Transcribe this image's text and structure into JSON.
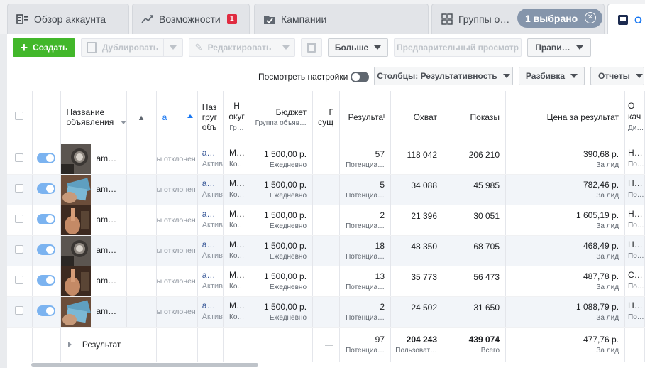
{
  "tabs": [
    {
      "label": "Обзор аккаунта",
      "icon": "account-overview-icon"
    },
    {
      "label": "Возможности",
      "icon": "trend-icon",
      "badge": "1"
    },
    {
      "label": "Кампании",
      "icon": "campaign-folder-icon"
    },
    {
      "label": "Группы о…",
      "icon": "ad-sets-grid-icon"
    },
    {
      "label": "О",
      "icon": "ads-icon"
    }
  ],
  "selection": {
    "label": "1 выбрано"
  },
  "toolbar": {
    "create": "Создать",
    "duplicate": "Дублировать",
    "edit": "Редактировать",
    "more": "Больше",
    "preview": "Предварительный просмотр",
    "rules": "Прави…"
  },
  "view_bar": {
    "view_settings": "Посмотреть настройки",
    "columns": "Столбцы: Результативность",
    "breakdown": "Разбивка",
    "reports": "Отчеты"
  },
  "columns": {
    "name": [
      "Название",
      "объявления"
    ],
    "delivery": "а",
    "adset_name": [
      "Наз",
      "груг",
      "объ"
    ],
    "audience": [
      "Н",
      "окуг",
      "Гр…"
    ],
    "budget": "Бюджет",
    "budget_sub": "Группа объяв…",
    "existing": [
      "Г",
      "сущ"
    ],
    "results": "Результаᴵ",
    "reach": "Охват",
    "impressions": "Показы",
    "cpr": "Цена за результат",
    "quality": [
      "О",
      "кач",
      "Ди…"
    ]
  },
  "rows": [
    {
      "name": "am…",
      "delivery": "ы отклонен",
      "adset": [
        "а…",
        "Актив"
      ],
      "aud": [
        "М…",
        "Ко…"
      ],
      "budget": "1 500,00 р.",
      "period": "Ежедневно",
      "results": "57",
      "res_sub": "Потенциа…",
      "reach": "118 042",
      "impressions": "206 210",
      "cpr": "390,68 р.",
      "cpr_sub": "За лид",
      "q": [
        "Н…",
        "По…"
      ],
      "thumb": "watch"
    },
    {
      "name": "am…",
      "delivery": "ы отклонен",
      "adset": [
        "а…",
        "Актив"
      ],
      "aud": [
        "М…",
        "Ко…"
      ],
      "budget": "1 500,00 р.",
      "period": "Ежедневно",
      "results": "5",
      "res_sub": "Потенциа…",
      "reach": "34 088",
      "impressions": "45 985",
      "cpr": "782,46 р.",
      "cpr_sub": "За лид",
      "q": [
        "Н…",
        "По…"
      ],
      "thumb": "money"
    },
    {
      "name": "am…",
      "delivery": "ы отклонен",
      "adset": [
        "а…",
        "Актив"
      ],
      "aud": [
        "М…",
        "Ко…"
      ],
      "budget": "1 500,00 р.",
      "period": "Ежедневно",
      "results": "2",
      "res_sub": "Потенциа…",
      "reach": "21 396",
      "impressions": "30 051",
      "cpr": "1 605,19 р.",
      "cpr_sub": "За лид",
      "q": [
        "Н…",
        "По…"
      ],
      "thumb": "hand"
    },
    {
      "name": "am…",
      "delivery": "ы отклонен",
      "adset": [
        "а…",
        "Актив"
      ],
      "aud": [
        "М…",
        "Ко…"
      ],
      "budget": "1 500,00 р.",
      "period": "Ежедневно",
      "results": "18",
      "res_sub": "Потенциа…",
      "reach": "48 350",
      "impressions": "68 705",
      "cpr": "468,49 р.",
      "cpr_sub": "За лид",
      "q": [
        "Н…",
        "По…"
      ],
      "thumb": "watch"
    },
    {
      "name": "am…",
      "delivery": "ы отклонен",
      "adset": [
        "а…",
        "Актив"
      ],
      "aud": [
        "М…",
        "Ко…"
      ],
      "budget": "1 500,00 р.",
      "period": "Ежедневно",
      "results": "13",
      "res_sub": "Потенциа…",
      "reach": "35 773",
      "impressions": "56 473",
      "cpr": "487,78 р.",
      "cpr_sub": "За лид",
      "q": [
        "С…",
        "По…"
      ],
      "thumb": "hand"
    },
    {
      "name": "am…",
      "delivery": "ы отклонен",
      "adset": [
        "а…",
        "Актив"
      ],
      "aud": [
        "М…",
        "Ко…"
      ],
      "budget": "1 500,00 р.",
      "period": "Ежедневно",
      "results": "2",
      "res_sub": "Потенциа…",
      "reach": "24 502",
      "impressions": "31 650",
      "cpr": "1 088,79 р.",
      "cpr_sub": "За лид",
      "q": [
        "Н…",
        "По…"
      ],
      "thumb": "money"
    }
  ],
  "summary": {
    "label": "Результат",
    "existing": "—",
    "results": "97",
    "res_sub": "Потенциа…",
    "reach": "204 243",
    "reach_sub": "Пользоват…",
    "impressions": "439 074",
    "impr_sub": "Всего",
    "cpr": "477,76 р.",
    "cpr_sub": "За лид"
  },
  "colors": {
    "accent": "#42b72a",
    "toggle_on": "#7bb3f0",
    "badge": "#e02c41",
    "pill": "#8595ab"
  }
}
